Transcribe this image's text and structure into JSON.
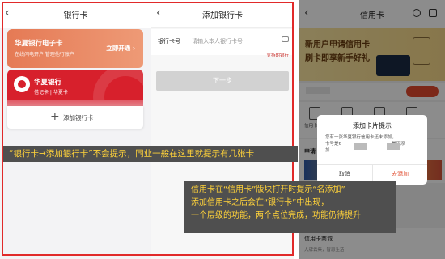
{
  "panel1": {
    "back": "‹",
    "title": "银行卡",
    "card1": {
      "name": "华夏银行电子卡",
      "sub": "在线闪电开户 管理他行账户",
      "action": "立即开通 ›"
    },
    "card2": {
      "name": "华夏银行",
      "sub": "借记卡 | 华夏卡"
    },
    "add_card": {
      "plus": "+",
      "label": "添加银行卡"
    }
  },
  "panel2": {
    "back": "‹",
    "title": "添加银行卡",
    "field_label": "银行卡号",
    "field_placeholder": "请输入本人银行卡号",
    "support": "支持的银行",
    "next": "下一步"
  },
  "panel3": {
    "back": "‹",
    "title": "信用卡",
    "banner_line1": "新用户申请信用卡",
    "banner_line2": "刷卡即享新手好礼",
    "icon_label": "信用卡",
    "apply_label": "申请",
    "shop_label": "信用卡商城",
    "shop_sub": "大牌云集，智惠生活",
    "dialog": {
      "title": "添加卡片提示",
      "msg_line1": "您有一张华夏银行信用卡还未添加，",
      "msg_line2": "卡号是6",
      "msg_line3": "是否添",
      "msg_line4": "加",
      "cancel": "取消",
      "confirm": "去添加"
    }
  },
  "annotations": {
    "note1": "“银行卡→添加银行卡”不会提示，同业一般在这里就提示有几张卡",
    "note2_line1": "信用卡在“信用卡”版块打开时提示“名添加”",
    "note2_line2": "添加信用卡之后会在“银行卡”中出现，",
    "note2_line3": "一个层级的功能，两个点位完成，功能仍待提升"
  }
}
